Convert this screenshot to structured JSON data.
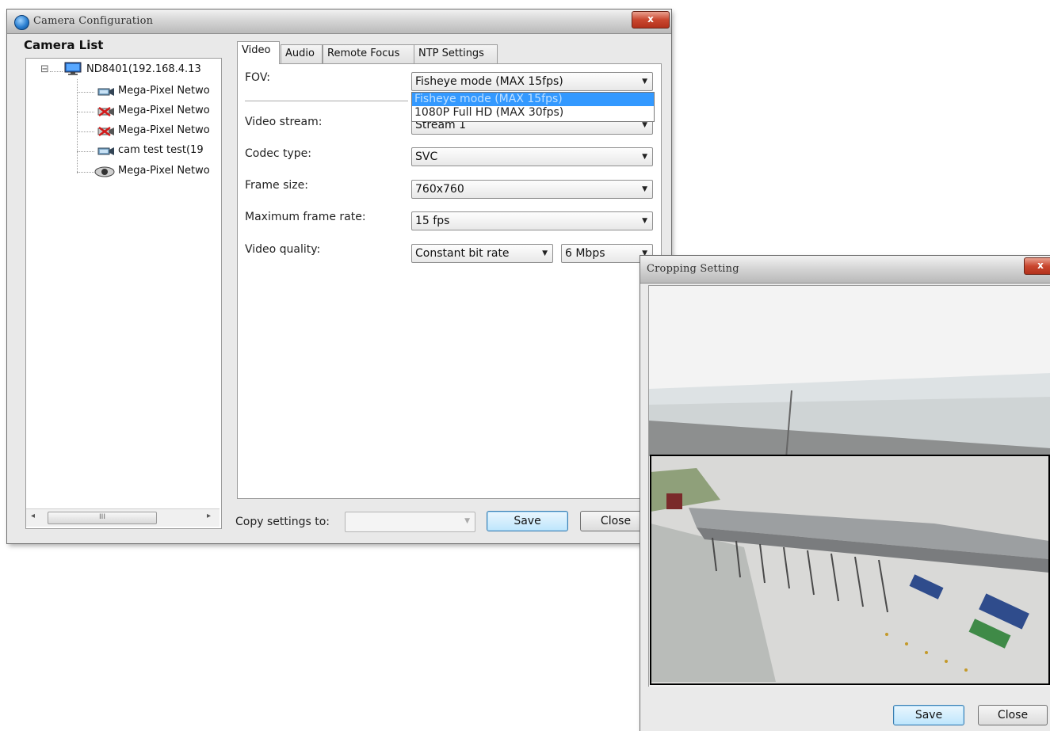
{
  "camera_config": {
    "title": "Camera Configuration",
    "close_glyph": "x",
    "camera_list_label": "Camera List",
    "tree": {
      "root": "ND8401(192.168.4.13",
      "expander": "⊟",
      "items": [
        {
          "label": "Mega-Pixel Netwo",
          "icon": "camera-icon"
        },
        {
          "label": "Mega-Pixel Netwo",
          "icon": "camera-disconnected-icon"
        },
        {
          "label": "Mega-Pixel Netwo",
          "icon": "camera-disconnected-icon"
        },
        {
          "label": "cam test test(19",
          "icon": "camera-icon"
        },
        {
          "label": "Mega-Pixel Netwo",
          "icon": "dome-camera-icon"
        }
      ]
    },
    "scrollbar": {
      "left": "◂",
      "right": "▸",
      "thumb_grip": "III"
    },
    "tabs": [
      "Video",
      "Audio",
      "Remote Focus",
      "NTP Settings"
    ],
    "fields": {
      "fov_label": "FOV:",
      "fov_value": "Fisheye mode (MAX 15fps)",
      "fov_options": [
        "Fisheye mode (MAX 15fps)",
        "1080P Full HD (MAX 30fps)"
      ],
      "video_stream_label": "Video stream:",
      "video_stream_value": "Stream 1",
      "codec_label": "Codec type:",
      "codec_value": "SVC",
      "frame_size_label": "Frame size:",
      "frame_size_value": "760x760",
      "max_frame_rate_label": "Maximum frame rate:",
      "max_frame_rate_value": "15 fps",
      "video_quality_label": "Video quality:",
      "video_quality_mode": "Constant bit rate",
      "video_quality_bitrate": "6 Mbps"
    },
    "copy_settings_label": "Copy settings to:",
    "copy_settings_value": "",
    "save_label": "Save",
    "close_label": "Close"
  },
  "cropping_setting": {
    "title": "Cropping Setting",
    "close_glyph": "x",
    "save_label": "Save",
    "close_label": "Close"
  },
  "colors": {
    "selection": "#3399ff",
    "close_button": "#c9472f",
    "disconnected_mark": "#d11a1a"
  }
}
